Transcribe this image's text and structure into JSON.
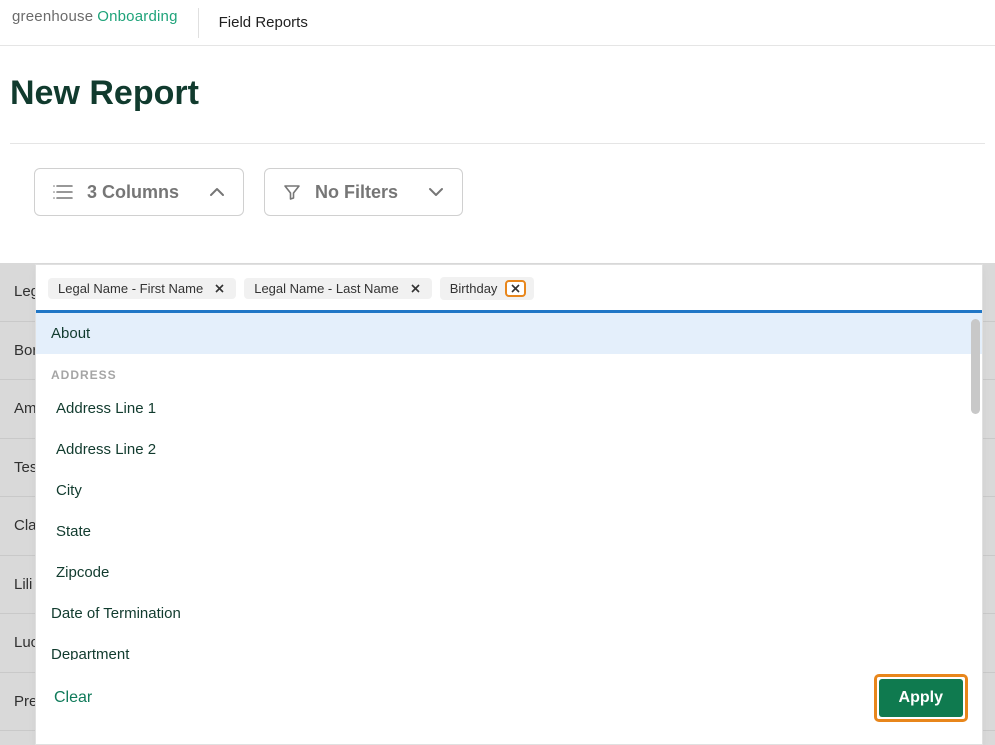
{
  "header": {
    "logo_left": "greenhouse",
    "logo_right": "Onboarding",
    "section": "Field Reports"
  },
  "page": {
    "title": "New Report"
  },
  "controls": {
    "columns_label": "3 Columns",
    "filters_label": "No Filters"
  },
  "background_rows": [
    "Leg",
    "Bor",
    "Am",
    "Tes",
    "Cla",
    "Lili",
    "Luc",
    "Pre"
  ],
  "panel": {
    "chips": [
      {
        "label": "Legal Name - First Name",
        "highlight": false
      },
      {
        "label": "Legal Name - Last Name",
        "highlight": false
      },
      {
        "label": "Birthday",
        "highlight": true
      }
    ],
    "options": [
      {
        "type": "item",
        "label": "About",
        "hover": true,
        "indent": false
      },
      {
        "type": "header",
        "label": "ADDRESS"
      },
      {
        "type": "item",
        "label": "Address Line 1",
        "hover": false,
        "indent": true
      },
      {
        "type": "item",
        "label": "Address Line 2",
        "hover": false,
        "indent": true
      },
      {
        "type": "item",
        "label": "City",
        "hover": false,
        "indent": true
      },
      {
        "type": "item",
        "label": "State",
        "hover": false,
        "indent": true
      },
      {
        "type": "item",
        "label": "Zipcode",
        "hover": false,
        "indent": true
      },
      {
        "type": "item",
        "label": "Date of Termination",
        "hover": false,
        "indent": false
      },
      {
        "type": "item",
        "label": "Department",
        "hover": false,
        "indent": false
      }
    ],
    "footer": {
      "clear": "Clear",
      "apply": "Apply"
    }
  }
}
